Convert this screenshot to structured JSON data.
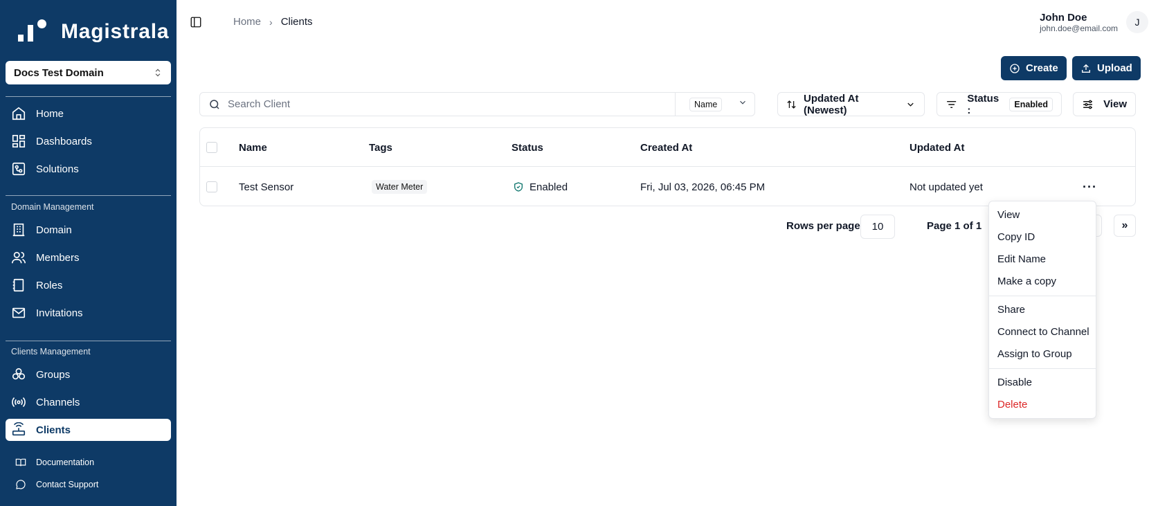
{
  "app": {
    "brand": "Magistrala"
  },
  "sidebar": {
    "domain": "Docs Test Domain",
    "main_items": [
      {
        "label": "Home",
        "icon": "home-icon"
      },
      {
        "label": "Dashboards",
        "icon": "dashboard-icon"
      },
      {
        "label": "Solutions",
        "icon": "solutions-icon"
      }
    ],
    "domain_management": {
      "label": "Domain Management",
      "items": [
        {
          "label": "Domain",
          "icon": "building-icon"
        },
        {
          "label": "Members",
          "icon": "users-icon"
        },
        {
          "label": "Roles",
          "icon": "book-icon"
        },
        {
          "label": "Invitations",
          "icon": "mail-icon"
        }
      ]
    },
    "clients_management": {
      "label": "Clients Management",
      "items": [
        {
          "label": "Groups",
          "icon": "groups-icon"
        },
        {
          "label": "Channels",
          "icon": "radio-icon"
        },
        {
          "label": "Clients",
          "icon": "router-icon",
          "active": true
        }
      ]
    },
    "footer_items": [
      {
        "label": "Documentation",
        "icon": "book-open-icon"
      },
      {
        "label": "Contact Support",
        "icon": "message-circle-icon"
      }
    ],
    "color": "#0e3a66"
  },
  "header": {
    "breadcrumb": {
      "home": "Home",
      "current": "Clients"
    },
    "user": {
      "name": "John Doe",
      "email": "john.doe@email.com",
      "initial": "J"
    }
  },
  "actions": {
    "create": "Create",
    "upload": "Upload"
  },
  "toolbar": {
    "search_placeholder": "Search Client",
    "search_field": "Name",
    "sort": "Updated At (Newest)",
    "status_label": "Status :",
    "status_value": "Enabled",
    "view": "View"
  },
  "table": {
    "columns": [
      "Name",
      "Tags",
      "Status",
      "Created At",
      "Updated At"
    ],
    "rows": [
      {
        "name": "Test Sensor",
        "tag": "Water Meter",
        "status": "Enabled",
        "created_at": "Fri, Jul 03, 2026, 06:45 PM",
        "updated_at": "Not updated yet",
        "more": "···"
      }
    ]
  },
  "pagination": {
    "rows_label": "Rows per page",
    "rows_value": "10",
    "page_label": "Page 1 of 1",
    "last": "»"
  },
  "context_menu": {
    "items": [
      "View",
      "Copy ID",
      "Edit Name",
      "Make a copy",
      "Share",
      "Connect to Channel",
      "Assign to Group",
      "Disable",
      "Delete"
    ],
    "danger_color": "#dc2626"
  }
}
